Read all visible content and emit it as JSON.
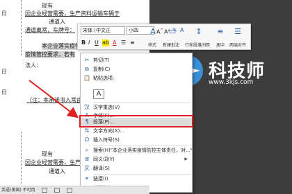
{
  "document": {
    "lines": [
      "现有",
      "因企业经营需要，生产资料运输车辆于",
      "通道入",
      "通道离常，车牌号：",
      "本企业落实疫情防控主体责任，对上述车",
      "疫情管控要求，若有",
      "法人：",
      "（注：本承诺书入常由",
      "现有",
      "因企业经营需要，生产资料运输车辆于",
      "通道入"
    ],
    "left_marks": [
      "日",
      "日",
      "日"
    ]
  },
  "mini_toolbar": {
    "font_name": "宋体 (中文正",
    "font_size": "小四",
    "captions": [
      "样式",
      "新建批注",
      "行和段落间距",
      "居中",
      "两端对齐"
    ]
  },
  "context_menu": {
    "items": [
      {
        "label": "剪切(T)",
        "icon": "scissors-icon"
      },
      {
        "label": "复制(C)",
        "icon": "copy-icon"
      },
      {
        "label": "粘贴选项:",
        "icon": "paste-icon"
      },
      {
        "label": "汉字重选(V)",
        "icon": "hanzi-icon"
      },
      {
        "label": "字体(F)...",
        "icon": "font-icon"
      },
      {
        "label": "段落(P)...",
        "icon": "paragraph-icon"
      },
      {
        "label": "文字方向(X)...",
        "icon": "text-direction-icon"
      },
      {
        "label": "插入符号(S)",
        "icon": "symbol-icon"
      },
      {
        "label": "搜索(H)\"本企业落实疫情防控主体责任，对...\"",
        "icon": "search-icon"
      },
      {
        "label": "同义词(Y)",
        "icon": "thesaurus-icon"
      },
      {
        "label": "翻译(S)",
        "icon": "translate-icon"
      },
      {
        "label": "链接(I)",
        "icon": "link-icon"
      },
      {
        "label": "新建批注(M)",
        "icon": "comment-icon"
      }
    ],
    "paste_glyph": "A"
  },
  "watermark": {
    "title": "科技师",
    "url": "www.3kjs.com"
  },
  "status_bar": {
    "text": "英语(美国)  不可用"
  },
  "colors": {
    "highlight_box": "#e02020",
    "accent": "#2a5fa8"
  }
}
